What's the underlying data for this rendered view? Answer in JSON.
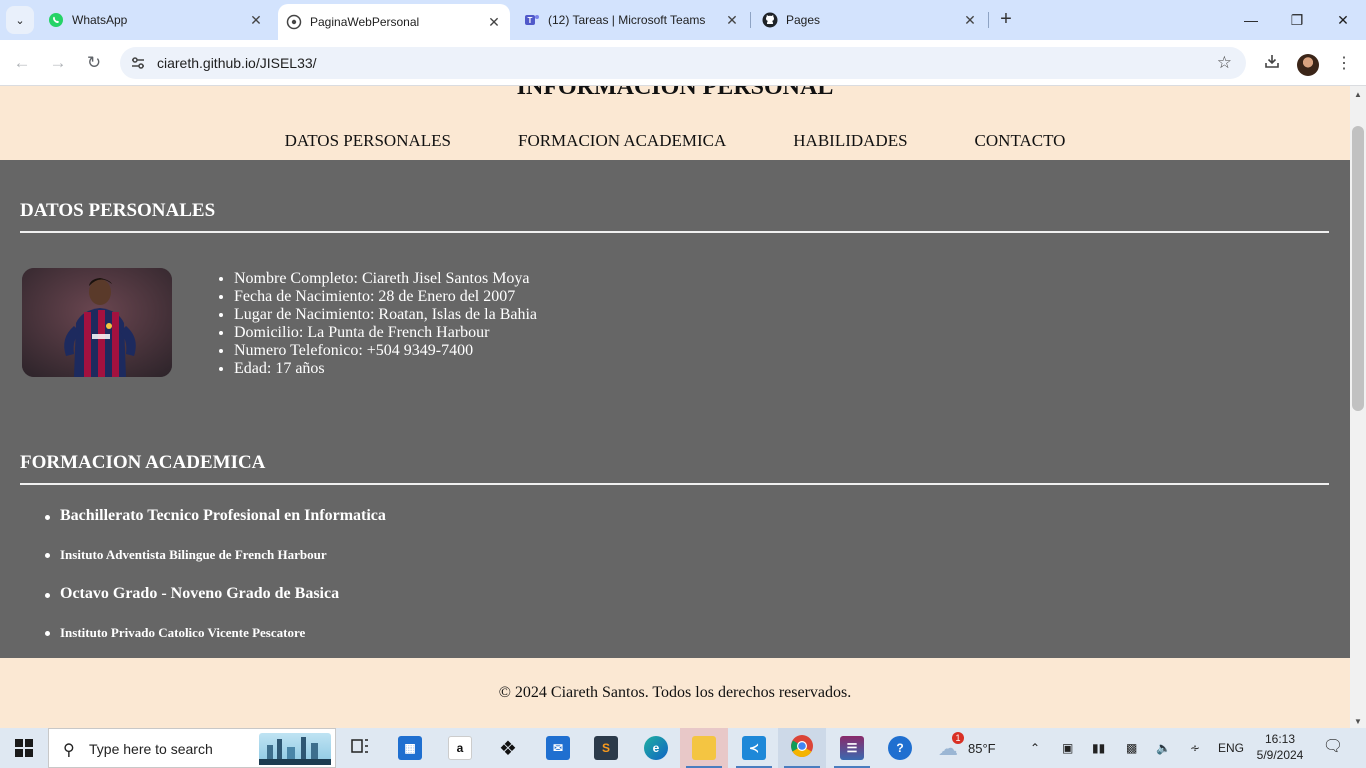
{
  "browser": {
    "tabs": [
      {
        "title": "WhatsApp",
        "icon": "whatsapp-icon",
        "active": false
      },
      {
        "title": "PaginaWebPersonal",
        "icon": "globe-icon",
        "active": true
      },
      {
        "title": "(12) Tareas | Microsoft Teams",
        "icon": "teams-icon",
        "active": false
      },
      {
        "title": "Pages",
        "icon": "github-icon",
        "active": false
      }
    ],
    "url": "ciareth.github.io/JISEL33/"
  },
  "page": {
    "title": "INFORMACION PERSONAL",
    "nav": [
      "DATOS PERSONALES",
      "FORMACION ACADEMICA",
      "HABILIDADES",
      "CONTACTO"
    ],
    "datos": {
      "heading": "DATOS PERSONALES",
      "items": [
        "Nombre Completo: Ciareth Jisel Santos Moya",
        "Fecha de Nacimiento: 28 de Enero del 2007",
        "Lugar de Nacimiento: Roatan, Islas de la Bahia",
        "Domicilio: La Punta de French Harbour",
        "Numero Telefonico: +504 9349-7400",
        "Edad: 17 años"
      ]
    },
    "formacion": {
      "heading": "FORMACION ACADEMICA",
      "items": [
        {
          "level": "Bachillerato Tecnico Profesional en Informatica",
          "school": "Insituto Adventista Bilingue de French Harbour"
        },
        {
          "level": "Octavo Grado - Noveno Grado de Basica",
          "school": "Instituto Privado Catolico Vicente Pescatore"
        }
      ]
    },
    "footer": "© 2024 Ciareth Santos. Todos los derechos reservados.",
    "colors": {
      "header_bg": "#fbe8d3",
      "main_bg": "#666666"
    }
  },
  "taskbar": {
    "search_placeholder": "Type here to search",
    "weather": "85°F",
    "weather_badge": "1",
    "language": "ENG",
    "time": "16:13",
    "date": "5/9/2024"
  }
}
